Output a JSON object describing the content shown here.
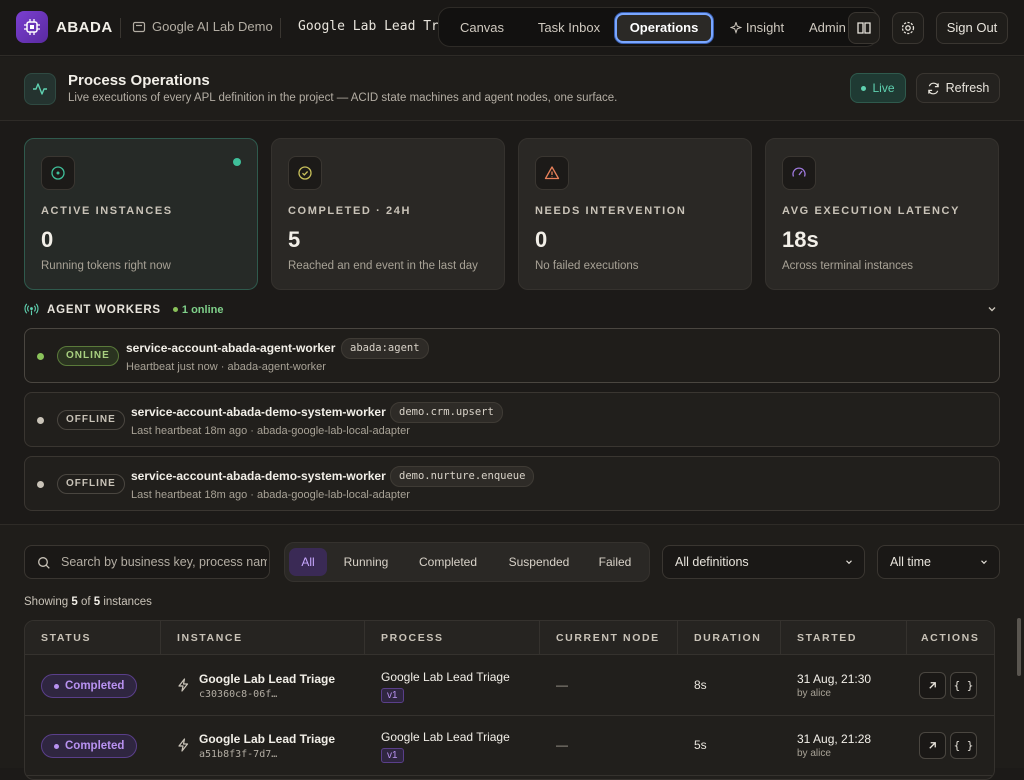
{
  "app": {
    "brand": "ABADA",
    "workspace": "Google AI Lab Demo",
    "document": "Google Lab Lead Triage",
    "nav": [
      "Canvas",
      "Task Inbox",
      "Operations",
      "Insight",
      "Admin"
    ],
    "active_nav": "Operations",
    "sign_out": "Sign Out"
  },
  "header": {
    "title": "Process Operations",
    "subtitle": "Live executions of every APL definition in the project — ACID state machines and agent nodes, one surface.",
    "live_label": "Live",
    "refresh_label": "Refresh"
  },
  "stats": [
    {
      "label": "ACTIVE INSTANCES",
      "value": "0",
      "desc": "Running tokens right now",
      "icon": "target-icon",
      "color": "#3fbf9a"
    },
    {
      "label": "COMPLETED · 24H",
      "value": "5",
      "desc": "Reached an end event in the last day",
      "icon": "check-circle-icon",
      "color": "#c8c05a"
    },
    {
      "label": "NEEDS INTERVENTION",
      "value": "0",
      "desc": "No failed executions",
      "icon": "warning-icon",
      "color": "#e8805a"
    },
    {
      "label": "AVG EXECUTION LATENCY",
      "value": "18s",
      "desc": "Across terminal instances",
      "icon": "gauge-icon",
      "color": "#a07ae0"
    }
  ],
  "workers": {
    "title": "AGENT WORKERS",
    "online_label": "1 online",
    "items": [
      {
        "status": "ONLINE",
        "name": "service-account-abada-agent-worker",
        "tag": "abada:agent",
        "meta": "Heartbeat just now · abada-agent-worker"
      },
      {
        "status": "OFFLINE",
        "name": "service-account-abada-demo-system-worker",
        "tag": "demo.crm.upsert",
        "meta": "Last heartbeat 18m ago · abada-google-lab-local-adapter"
      },
      {
        "status": "OFFLINE",
        "name": "service-account-abada-demo-system-worker",
        "tag": "demo.nurture.enqueue",
        "meta": "Last heartbeat 18m ago · abada-google-lab-local-adapter"
      }
    ]
  },
  "filters": {
    "search_placeholder": "Search by business key, process name",
    "segments": [
      "All",
      "Running",
      "Completed",
      "Suspended",
      "Failed"
    ],
    "active_segment": "All",
    "definitions": "All definitions",
    "time": "All time",
    "showing_prefix": "Showing",
    "showing_count": "5",
    "showing_of": "of",
    "showing_total": "5",
    "showing_suffix": "instances"
  },
  "table": {
    "columns": [
      "STATUS",
      "INSTANCE",
      "PROCESS",
      "CURRENT NODE",
      "DURATION",
      "STARTED",
      "ACTIONS"
    ],
    "rows": [
      {
        "status": "Completed",
        "instance": "Google Lab Lead Triage",
        "id": "c30360c8-06f…",
        "process": "Google Lab Lead Triage",
        "version": "v1",
        "node": "—",
        "duration": "8s",
        "started": "31 Aug, 21:30",
        "by": "by alice"
      },
      {
        "status": "Completed",
        "instance": "Google Lab Lead Triage",
        "id": "a51b8f3f-7d7…",
        "process": "Google Lab Lead Triage",
        "version": "v1",
        "node": "—",
        "duration": "5s",
        "started": "31 Aug, 21:28",
        "by": "by alice"
      }
    ],
    "action_json_label": "{ }"
  }
}
